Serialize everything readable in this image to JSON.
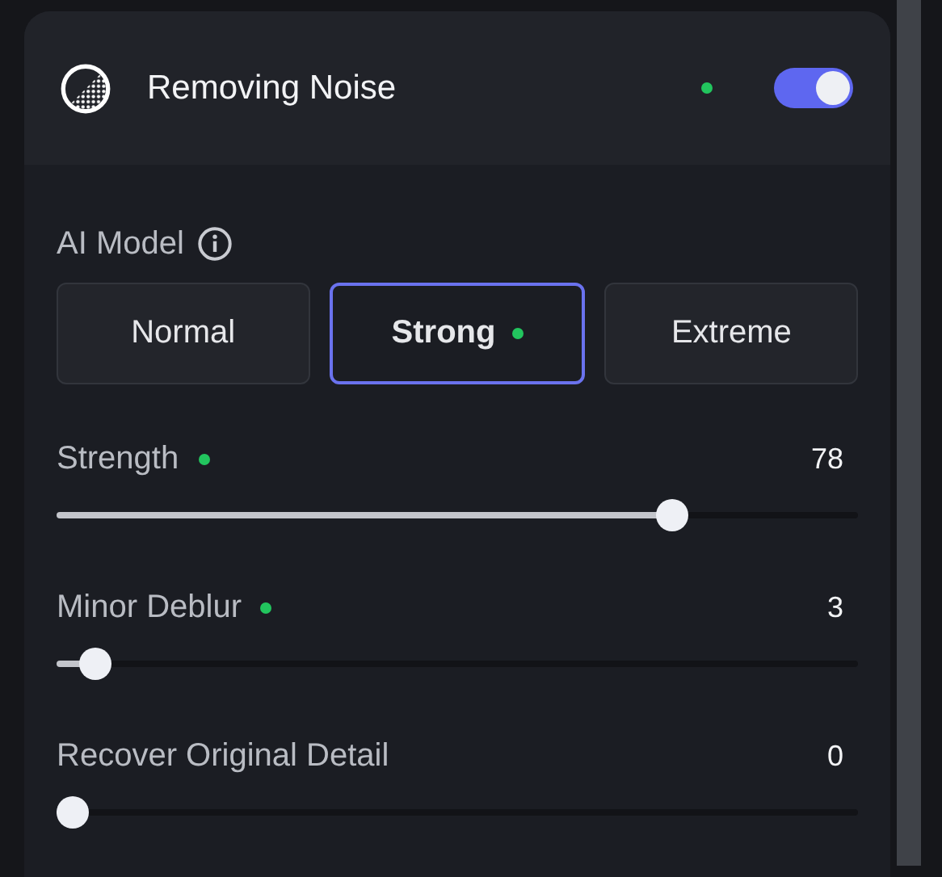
{
  "panel": {
    "title": "Removing Noise",
    "modified": true,
    "enabled": true
  },
  "model": {
    "label": "AI Model",
    "options": [
      {
        "label": "Normal",
        "selected": false,
        "modified": false
      },
      {
        "label": "Strong",
        "selected": true,
        "modified": true
      },
      {
        "label": "Extreme",
        "selected": false,
        "modified": false
      }
    ]
  },
  "sliders": [
    {
      "label": "Strength",
      "modified": true,
      "reading": "78",
      "level": 0.78
    },
    {
      "label": "Minor Deblur",
      "modified": true,
      "reading": "3",
      "level": 0.03
    },
    {
      "label": "Recover Original Detail",
      "modified": false,
      "reading": "0",
      "level": 0
    }
  ]
}
